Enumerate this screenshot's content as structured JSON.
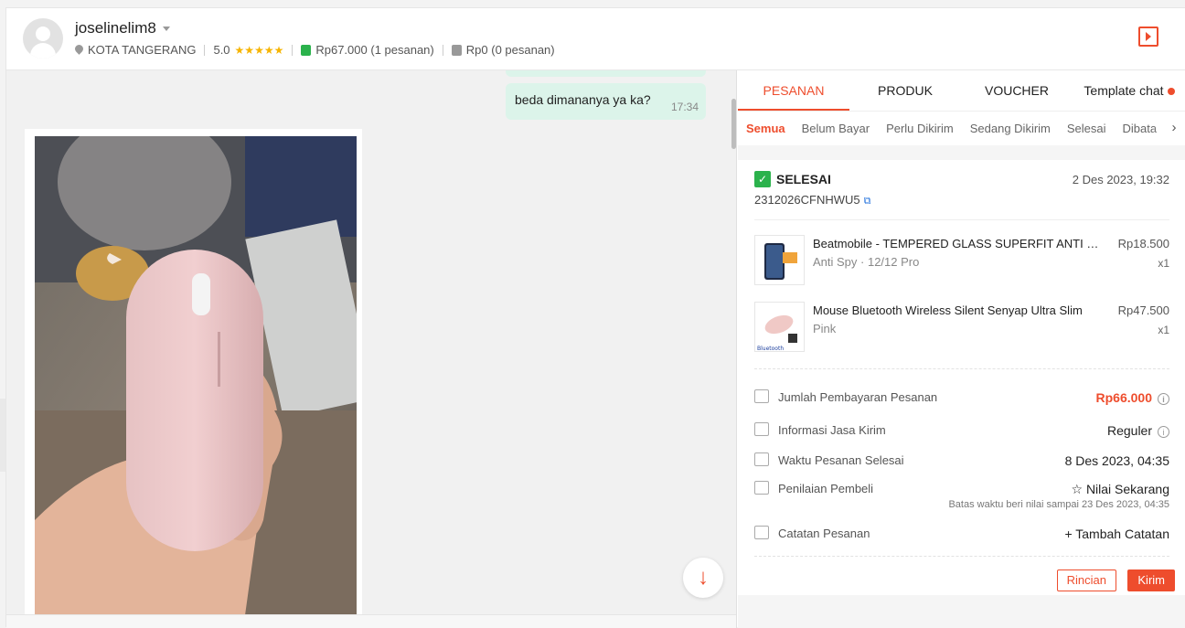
{
  "header": {
    "username": "joselinelim8",
    "location": "KOTA TANGERANG",
    "rating": "5.0",
    "stars": "★★★★★",
    "paid_amount": "Rp67.000",
    "paid_orders": "(1 pesanan)",
    "unpaid_amount": "Rp0",
    "unpaid_orders": "(0 pesanan)"
  },
  "chat": {
    "messages": [
      {
        "text": "beda dimananya ya ka?",
        "time": "17:34"
      }
    ]
  },
  "tabs": [
    {
      "label": "PESANAN",
      "active": true
    },
    {
      "label": "PRODUK"
    },
    {
      "label": "VOUCHER"
    },
    {
      "label": "Template chat"
    }
  ],
  "subtabs": [
    "Semua",
    "Belum Bayar",
    "Perlu Dikirim",
    "Sedang Dikirim",
    "Selesai",
    "Dibata"
  ],
  "order": {
    "status": "SELESAI",
    "date": "2 Des 2023, 19:32",
    "id": "2312026CFNHWU5",
    "items": [
      {
        "name": "Beatmobile - TEMPERED GLASS SUPERFIT ANTI SPY",
        "variant": "Anti Spy · 12/12 Pro",
        "price": "Rp18.500",
        "qty": "x1"
      },
      {
        "name": "Mouse Bluetooth Wireless Silent Senyap Ultra Slim",
        "variant": "Pink",
        "price": "Rp47.500",
        "qty": "x1",
        "thumb_text": "Bluetooth"
      }
    ],
    "rows": {
      "payment_label": "Jumlah Pembayaran Pesanan",
      "payment_value": "Rp66.000",
      "shipping_label": "Informasi Jasa Kirim",
      "shipping_value": "Reguler",
      "completed_label": "Waktu Pesanan Selesai",
      "completed_value": "8 Des 2023, 04:35",
      "review_label": "Penilaian Pembeli",
      "review_action": "☆ Nilai Sekarang",
      "review_note": "Batas waktu beri nilai sampai 23 Des 2023, 04:35",
      "notes_label": "Catatan Pesanan",
      "notes_action": "+ Tambah Catatan"
    },
    "buttons": {
      "details": "Rincian",
      "send": "Kirim"
    }
  },
  "colors": {
    "accent": "#ee4d2d",
    "bubble": "#dcf4ea",
    "link": "#2673dd",
    "success": "#2bb24c"
  }
}
